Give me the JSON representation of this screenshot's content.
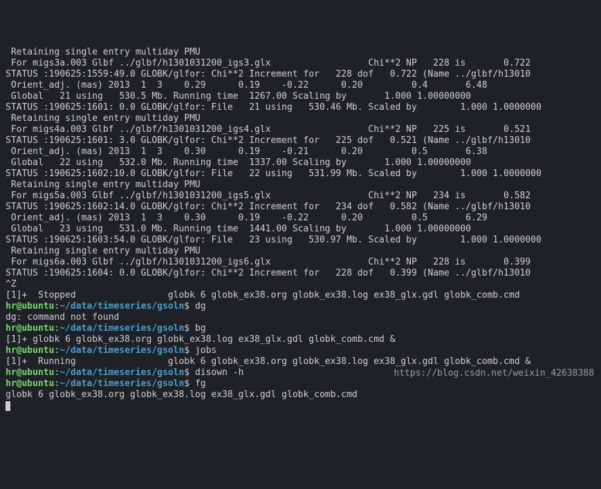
{
  "lines": {
    "l01": " Retaining single entry multiday PMU",
    "l02": " For migs3a.003 Glbf ../glbf/h1301031200_igs3.glx                  Chi**2 NP   228 is       0.722",
    "l03": "STATUS :190625:1559:49.0 GLOBK/glfor: Chi**2 Increment for   228 dof   0.722 (Name ../glbf/h13010",
    "l04": " Orient_adj. (mas) 2013  1  3    0.29      0.19    -0.22      0.20         0.4       6.48",
    "l05": " Global   21 using   530.5 Mb. Running time  1267.00 Scaling by       1.000 1.00000000",
    "l06": "STATUS :190625:1601: 0.0 GLOBK/glfor: File   21 using   530.46 Mb. Scaled by        1.000 1.0000000",
    "l07": " Retaining single entry multiday PMU",
    "l08": " For migs4a.003 Glbf ../glbf/h1301031200_igs4.glx                  Chi**2 NP   225 is       0.521",
    "l09": "STATUS :190625:1601: 3.0 GLOBK/glfor: Chi**2 Increment for   225 dof   0.521 (Name ../glbf/h13010",
    "l10": " Orient_adj. (mas) 2013  1  3    0.30      0.19    -0.21      0.20         0.5       6.38",
    "l11": " Global   22 using   532.0 Mb. Running time  1337.00 Scaling by       1.000 1.00000000",
    "l12": "STATUS :190625:1602:10.0 GLOBK/glfor: File   22 using   531.99 Mb. Scaled by        1.000 1.0000000",
    "l13": " Retaining single entry multiday PMU",
    "l14": " For migs5a.003 Glbf ../glbf/h1301031200_igs5.glx                  Chi**2 NP   234 is       0.582",
    "l15": "STATUS :190625:1602:14.0 GLOBK/glfor: Chi**2 Increment for   234 dof   0.582 (Name ../glbf/h13010",
    "l16": " Orient_adj. (mas) 2013  1  3    0.30      0.19    -0.22      0.20         0.5       6.29",
    "l17": " Global   23 using   531.0 Mb. Running time  1441.00 Scaling by       1.000 1.00000000",
    "l18": "STATUS :190625:1603:54.0 GLOBK/glfor: File   23 using   530.97 Mb. Scaled by        1.000 1.0000000",
    "l19": " Retaining single entry multiday PMU",
    "l20": " For migs6a.003 Glbf ../glbf/h1301031200_igs6.glx                  Chi**2 NP   228 is       0.399",
    "l21": "STATUS :190625:1604: 0.0 GLOBK/glfor: Chi**2 Increment for   228 dof   0.399 (Name ../glbf/h13010",
    "l22": "^Z",
    "l23": "[1]+  Stopped                 globk 6 globk_ex38.org globk_ex38.log ex38_glx.gdl globk_comb.cmd",
    "l25": "dg: command not found",
    "l27": "[1]+ globk 6 globk_ex38.org globk_ex38.log ex38_glx.gdl globk_comb.cmd &",
    "l29": "[1]+  Running                 globk 6 globk_ex38.org globk_ex38.log ex38_glx.gdl globk_comb.cmd &",
    "l31": "globk 6 globk_ex38.org globk_ex38.log ex38_glx.gdl globk_comb.cmd"
  },
  "prompts": {
    "p1": {
      "user": "hr@ubuntu",
      "colon": ":",
      "path": "~/data/timeseries/gsoln",
      "dollar": "$ ",
      "cmd": "dg"
    },
    "p2": {
      "user": "hr@ubuntu",
      "colon": ":",
      "path": "~/data/timeseries/gsoln",
      "dollar": "$ ",
      "cmd": "bg"
    },
    "p3": {
      "user": "hr@ubuntu",
      "colon": ":",
      "path": "~/data/timeseries/gsoln",
      "dollar": "$ ",
      "cmd": "jobs"
    },
    "p4": {
      "user": "hr@ubuntu",
      "colon": ":",
      "path": "~/data/timeseries/gsoln",
      "dollar": "$ ",
      "cmd": "disown -h"
    },
    "p5": {
      "user": "hr@ubuntu",
      "colon": ":",
      "path": "~/data/timeseries/gsoln",
      "dollar": "$ ",
      "cmd": "fg"
    }
  },
  "watermark": "https://blog.csdn.net/weixin_42638388"
}
